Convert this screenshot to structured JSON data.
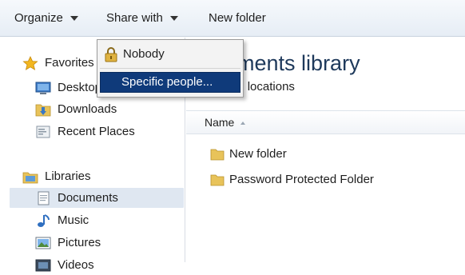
{
  "toolbar": {
    "organize_label": "Organize",
    "share_with_label": "Share with",
    "new_folder_label": "New folder"
  },
  "share_menu": {
    "nobody_label": "Nobody",
    "specific_people_label": "Specific people..."
  },
  "nav": {
    "favorites": "Favorites",
    "desktop": "Desktop",
    "downloads": "Downloads",
    "recent_places": "Recent Places",
    "libraries": "Libraries",
    "documents": "Documents",
    "music": "Music",
    "pictures": "Pictures",
    "videos": "Videos"
  },
  "main": {
    "library_title": "Documents library",
    "library_subtitle": "Includes: 2 locations",
    "column_name": "Name",
    "files": [
      {
        "name": "New folder"
      },
      {
        "name": "Password Protected Folder"
      }
    ]
  },
  "colors": {
    "menu_highlight": "#0f3a7a",
    "title_text": "#1e395b",
    "folder_yellow": "#e8c35a"
  },
  "icons": [
    "star-icon",
    "desktop-icon",
    "downloads-folder-icon",
    "recent-places-icon",
    "libraries-icon",
    "documents-icon",
    "music-icon",
    "pictures-icon",
    "videos-icon",
    "lock-icon",
    "folder-icon",
    "dropdown-caret-icon",
    "sort-ascending-icon"
  ]
}
